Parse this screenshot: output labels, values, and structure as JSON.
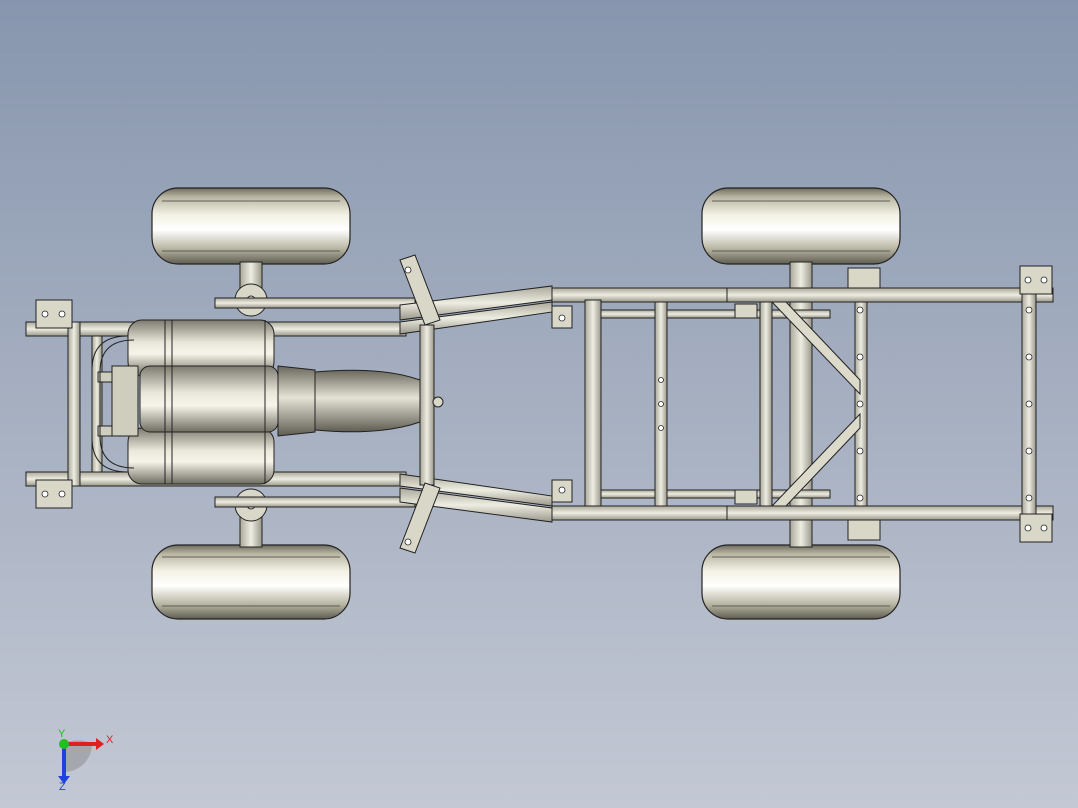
{
  "viewport": {
    "background_top": "#8796ae",
    "background_bottom": "#c3c8d4"
  },
  "model": {
    "frame_color": "#d2d0c0",
    "edge_color": "#2a2a2a",
    "tire_color": "#d8d5c2",
    "wheels": 4
  },
  "triad": {
    "x_label": "X",
    "y_label": "Y",
    "z_label": "Z",
    "x_color": "#e02020",
    "y_color": "#20c020",
    "z_color": "#2040e0"
  }
}
